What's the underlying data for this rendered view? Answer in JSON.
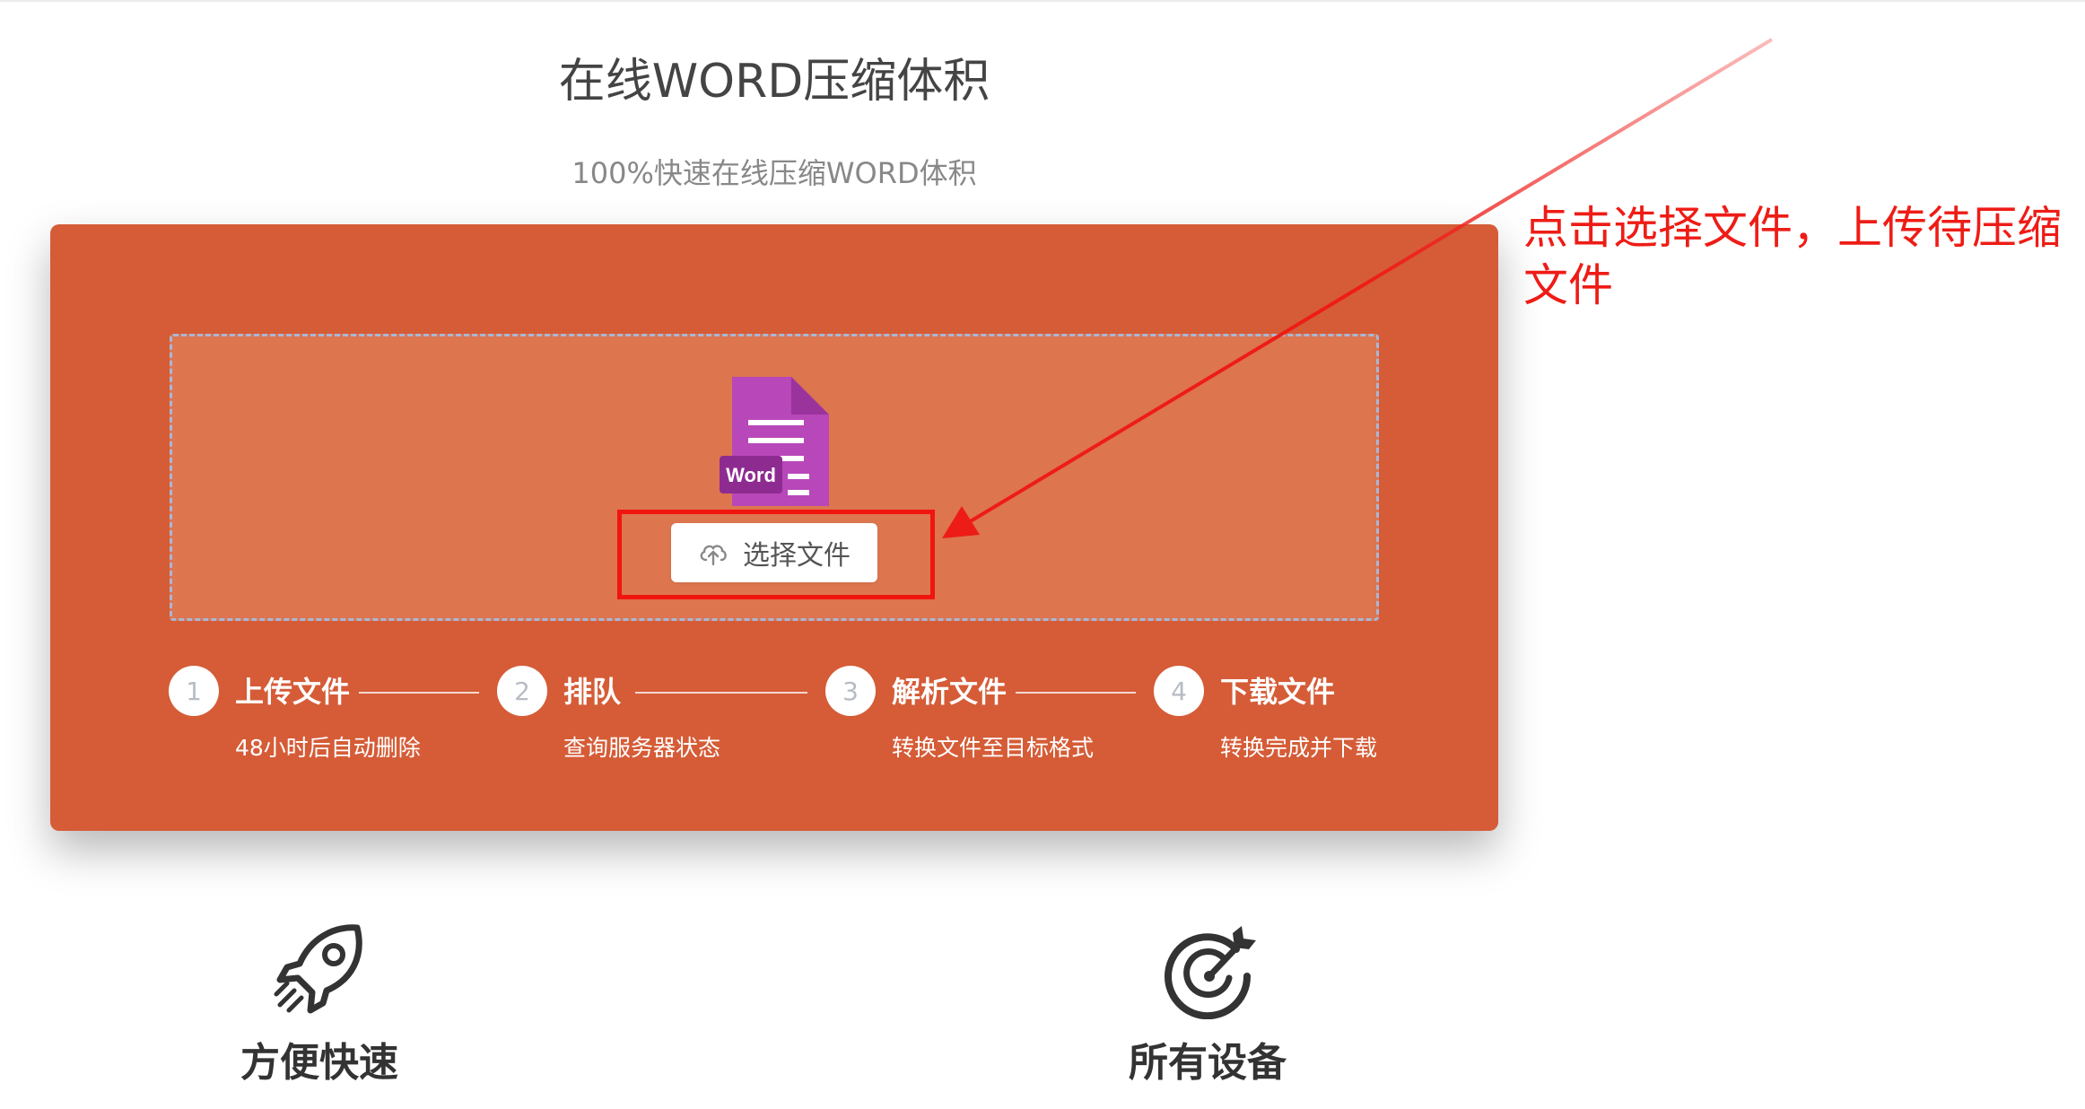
{
  "header": {
    "title": "在线WORD压缩体积",
    "subtitle": "100%快速在线压缩WORD体积"
  },
  "upload": {
    "file_type_badge": "Word",
    "select_button_label": "选择文件",
    "upload_icon": "cloud-upload-icon",
    "file_icon": "word-document-icon"
  },
  "steps": [
    {
      "number": "1",
      "title": "上传文件",
      "desc": "48小时后自动删除"
    },
    {
      "number": "2",
      "title": "排队",
      "desc": "查询服务器状态"
    },
    {
      "number": "3",
      "title": "解析文件",
      "desc": "转换文件至目标格式"
    },
    {
      "number": "4",
      "title": "下载文件",
      "desc": "转换完成并下载"
    }
  ],
  "features": [
    {
      "label": "方便快速",
      "icon": "rocket-icon"
    },
    {
      "label": "所有设备",
      "icon": "target-icon"
    }
  ],
  "annotation": {
    "text": "点击选择文件，上传待压缩文件"
  },
  "colors": {
    "panel_background": "#d55c37",
    "drop_zone_fill": "#dd754f",
    "word_icon": "#b847b9",
    "annotation_red": "#ee1c16",
    "heading_text": "#444444"
  }
}
